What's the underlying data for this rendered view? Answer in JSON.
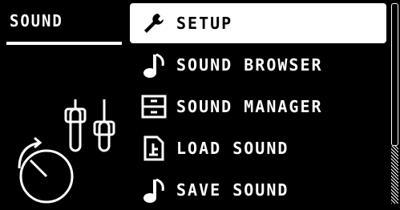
{
  "header": {
    "title": "SOUND"
  },
  "menu": {
    "items": [
      {
        "label": "SETUP",
        "icon": "wrench-icon",
        "selected": true
      },
      {
        "label": "SOUND BROWSER",
        "icon": "music-note-icon",
        "selected": false
      },
      {
        "label": "SOUND MANAGER",
        "icon": "drawer-icon",
        "selected": false
      },
      {
        "label": "LOAD SOUND",
        "icon": "load-file-icon",
        "selected": false
      },
      {
        "label": "SAVE SOUND",
        "icon": "music-note-icon",
        "selected": false
      }
    ]
  },
  "decor": {
    "left_icons": [
      "sliders-icon",
      "knob-icon"
    ]
  },
  "colors": {
    "background": "#000000",
    "foreground": "#ffffff"
  }
}
